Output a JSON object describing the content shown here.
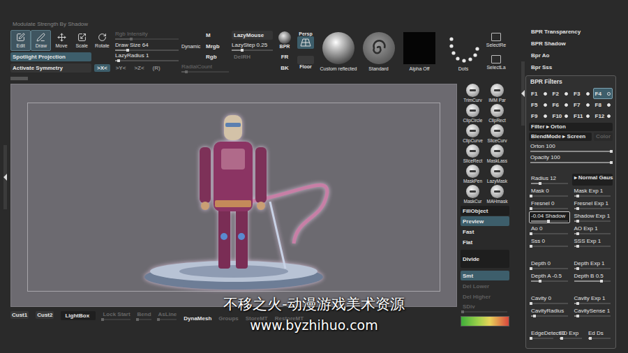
{
  "window": {
    "status": "Modulate Strength By Shadow"
  },
  "toolbar": {
    "tools": [
      {
        "label": "Edit",
        "selected": true
      },
      {
        "label": "Draw",
        "selected": true
      },
      {
        "label": "Move",
        "selected": false
      },
      {
        "label": "Scale",
        "selected": false
      },
      {
        "label": "Rotate",
        "selected": false
      }
    ],
    "spotlight": {
      "label": "Spotlight Projection",
      "selected": true
    },
    "symmetry": {
      "label": "Activate Symmetry",
      "selected": false
    },
    "axes": [
      {
        "label": ">X<",
        "selected": true
      },
      {
        "label": ">Y<",
        "selected": false
      },
      {
        "label": ">Z<",
        "selected": false
      },
      {
        "label": "(R)",
        "selected": false
      }
    ],
    "sliders": [
      {
        "label": "Rgb Intensity",
        "level": 0.25,
        "disabled": true
      },
      {
        "label": "Draw Size 64",
        "level": 0.2,
        "disabled": false
      },
      {
        "label": "LazyRadius 1",
        "level": 0.05,
        "disabled": false
      }
    ],
    "radialCount": {
      "label": "RadialCount",
      "level": 0.1,
      "disabled": true
    },
    "dynamic": "Dynamic",
    "modes": [
      {
        "label": "M",
        "selected": false
      },
      {
        "label": "Mrgb",
        "selected": false
      },
      {
        "label": "Rgb",
        "selected": false
      }
    ],
    "lazyMouse": {
      "label": "LazyMouse",
      "selected": false
    },
    "lazyStep": {
      "label": "LazyStep 0.25",
      "level": 0.25
    },
    "delRh": {
      "label": "DelRH",
      "disabled": true
    },
    "bpr": "BPR",
    "fr": "FR",
    "bk": "BK",
    "persp": {
      "label": "Persp",
      "selected": true
    },
    "floor": {
      "label": "Floor",
      "selected": false
    },
    "materials": [
      {
        "label": "Custom reflected",
        "kind": "material"
      },
      {
        "label": "Standard",
        "kind": "brush"
      },
      {
        "label": "Alpha Off",
        "kind": "alpha"
      },
      {
        "label": "Dots",
        "kind": "stroke"
      }
    ],
    "select": [
      "SelectRe",
      "SelectLa"
    ]
  },
  "shelf": {
    "tools": [
      "TrimCurv",
      "IMM Par",
      "ClipCircle",
      "ClipRect",
      "ClipCurve",
      "SliceCurv",
      "SliceRect",
      "MaskLass",
      "MaskPen",
      "LazyMask",
      "MaskCur",
      "MAHmask"
    ],
    "buttons": [
      {
        "label": "FillObject",
        "kind": "dark",
        "selected": false,
        "disabled": false
      },
      {
        "label": "Preview",
        "kind": "button",
        "selected": true,
        "disabled": false
      },
      {
        "label": "Fast",
        "kind": "button",
        "selected": false,
        "disabled": false
      },
      {
        "label": "Flat",
        "kind": "button",
        "selected": false,
        "disabled": false
      },
      {
        "label": "Divide",
        "kind": "tall",
        "selected": false,
        "disabled": false
      },
      {
        "label": "Smt",
        "kind": "button",
        "selected": true,
        "disabled": false
      },
      {
        "label": "Del Lower",
        "kind": "button",
        "selected": false,
        "disabled": true
      },
      {
        "label": "Del Higher",
        "kind": "button",
        "selected": false,
        "disabled": true
      },
      {
        "label": "SDiv",
        "kind": "slider",
        "selected": false,
        "disabled": true,
        "level": 0
      }
    ]
  },
  "bottomBar": [
    {
      "label": "Cust1",
      "kind": "tab",
      "disabled": false
    },
    {
      "label": "Cust2",
      "kind": "tab",
      "disabled": false
    },
    {
      "label": "LightBox",
      "kind": "button",
      "disabled": false
    },
    {
      "label": "Lock Start",
      "kind": "slider",
      "disabled": true,
      "level": 0
    },
    {
      "label": "Bend",
      "kind": "slider",
      "disabled": true,
      "level": 0
    },
    {
      "label": "AsLine",
      "kind": "slider",
      "disabled": true,
      "level": 0
    },
    {
      "label": "DynaMesh",
      "kind": "label",
      "disabled": false
    },
    {
      "label": "Groups",
      "kind": "label",
      "disabled": true
    },
    {
      "label": "StoreMT",
      "kind": "label",
      "disabled": true
    },
    {
      "label": "RestoreMT",
      "kind": "label",
      "disabled": true
    }
  ],
  "bprPanel": {
    "toggles": [
      "BPR Transparency",
      "BPR Shadow",
      "Bpr Ao",
      "Bpr Sss"
    ],
    "title": "BPR Filters",
    "filters": [
      {
        "label": "F1",
        "selected": false
      },
      {
        "label": "F2",
        "selected": false
      },
      {
        "label": "F3",
        "selected": false
      },
      {
        "label": "F4",
        "selected": true
      },
      {
        "label": "F5",
        "selected": false
      },
      {
        "label": "F6",
        "selected": false
      },
      {
        "label": "F7",
        "selected": false
      },
      {
        "label": "F8",
        "selected": false
      },
      {
        "label": "F9",
        "selected": false
      },
      {
        "label": "F10",
        "selected": false
      },
      {
        "label": "F11",
        "selected": false
      },
      {
        "label": "F12",
        "selected": false
      }
    ],
    "filter": "Filter ▸ Orton",
    "blendMode": "BlendMode ▸ Screen",
    "color": {
      "label": "Color",
      "disabled": true
    },
    "mainSliders": [
      {
        "label": "Orton 100",
        "level": 1
      },
      {
        "label": "Opacity 100",
        "level": 1
      }
    ],
    "groups": [
      [
        [
          {
            "label": "Radius 12",
            "kind": "slider",
            "level": 0.24,
            "active": false
          },
          {
            "label": "▸ Normal Gaus",
            "kind": "dropdown",
            "level": 0,
            "active": false
          }
        ],
        [
          {
            "label": "Mask 0",
            "kind": "slider",
            "level": 0,
            "active": false
          },
          {
            "label": "Mask Exp 1",
            "kind": "slider",
            "level": 0.1,
            "active": false
          }
        ],
        [
          {
            "label": "Fresnel 0",
            "kind": "slider",
            "level": 0,
            "active": false
          },
          {
            "label": "Fresnel Exp 1",
            "kind": "slider",
            "level": 0.1,
            "active": false
          }
        ],
        [
          {
            "label": "-0.04 Shadow",
            "kind": "slider",
            "level": 0.48,
            "active": true
          },
          {
            "label": "Shadow Exp 1",
            "kind": "slider",
            "level": 0.1,
            "active": false
          }
        ],
        [
          {
            "label": "Ao 0",
            "kind": "slider",
            "level": 0,
            "active": false
          },
          {
            "label": "AO Exp 1",
            "kind": "slider",
            "level": 0.1,
            "active": false
          }
        ],
        [
          {
            "label": "Sss 0",
            "kind": "slider",
            "level": 0,
            "active": false
          },
          {
            "label": "SSS Exp 1",
            "kind": "slider",
            "level": 0.1,
            "active": false
          }
        ]
      ],
      [
        [
          {
            "label": "Depth 0",
            "kind": "slider",
            "level": 0,
            "active": false
          },
          {
            "label": "Depth Exp 1",
            "kind": "slider",
            "level": 0.1,
            "active": false
          }
        ],
        [
          {
            "label": "Depth A -0.5",
            "kind": "slider",
            "level": 0.25,
            "active": false
          },
          {
            "label": "Depth B 0.5",
            "kind": "slider",
            "level": 0.75,
            "active": false
          }
        ]
      ],
      [
        [
          {
            "label": "Cavity 0",
            "kind": "slider",
            "level": 0,
            "active": false
          },
          {
            "label": "Cavity Exp 1",
            "kind": "slider",
            "level": 0.1,
            "active": false
          }
        ],
        [
          {
            "label": "CavityRadius",
            "kind": "slider",
            "level": 0.1,
            "active": false
          },
          {
            "label": "CavitySense 1",
            "kind": "slider",
            "level": 0.1,
            "active": false
          }
        ]
      ],
      [
        [
          {
            "label": "EdgeDetect 0",
            "kind": "slider",
            "level": 0,
            "active": false
          },
          {
            "label": "ED Exp",
            "kind": "slider",
            "level": 0.1,
            "active": false
          },
          {
            "label": "Ed Ds",
            "kind": "slider",
            "level": 0.1,
            "active": false
          }
        ]
      ]
    ]
  },
  "watermark": {
    "line1": "不移之火-动漫游戏美术资源",
    "line2": "www.byzhihuo.com"
  }
}
